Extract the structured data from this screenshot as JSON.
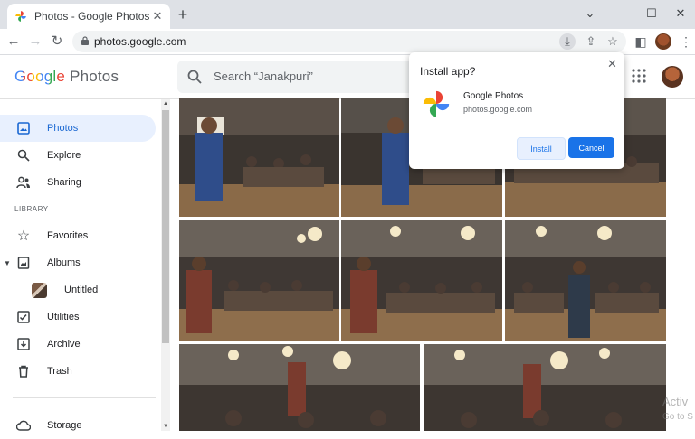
{
  "browser": {
    "tab_title": "Photos - Google Photos",
    "tab_close": "✕",
    "new_tab": "+",
    "url": "photos.google.com"
  },
  "app": {
    "logo_google": "Google",
    "logo_photos": "Photos",
    "search_placeholder": "Search “Janakpuri”"
  },
  "sidebar": {
    "nav": [
      {
        "label": "Photos",
        "icon": "photo-icon",
        "active": true
      },
      {
        "label": "Explore",
        "icon": "search-icon"
      },
      {
        "label": "Sharing",
        "icon": "people-icon"
      }
    ],
    "library_header": "LIBRARY",
    "library": [
      {
        "label": "Favorites",
        "icon": "star-icon"
      },
      {
        "label": "Albums",
        "icon": "album-icon"
      },
      {
        "label": "Untitled",
        "icon": "album-thumbnail"
      },
      {
        "label": "Utilities",
        "icon": "utilities-icon"
      },
      {
        "label": "Archive",
        "icon": "archive-icon"
      },
      {
        "label": "Trash",
        "icon": "trash-icon"
      }
    ],
    "storage_label": "Storage"
  },
  "install_popup": {
    "title": "Install app?",
    "app_name": "Google Photos",
    "app_url": "photos.google.com",
    "install_label": "Install",
    "cancel_label": "Cancel"
  },
  "watermark": {
    "line1": "Activ",
    "line2": "Go to S"
  },
  "colors": {
    "accent": "#1a73e8",
    "active_nav_bg": "#e8f0fe"
  }
}
